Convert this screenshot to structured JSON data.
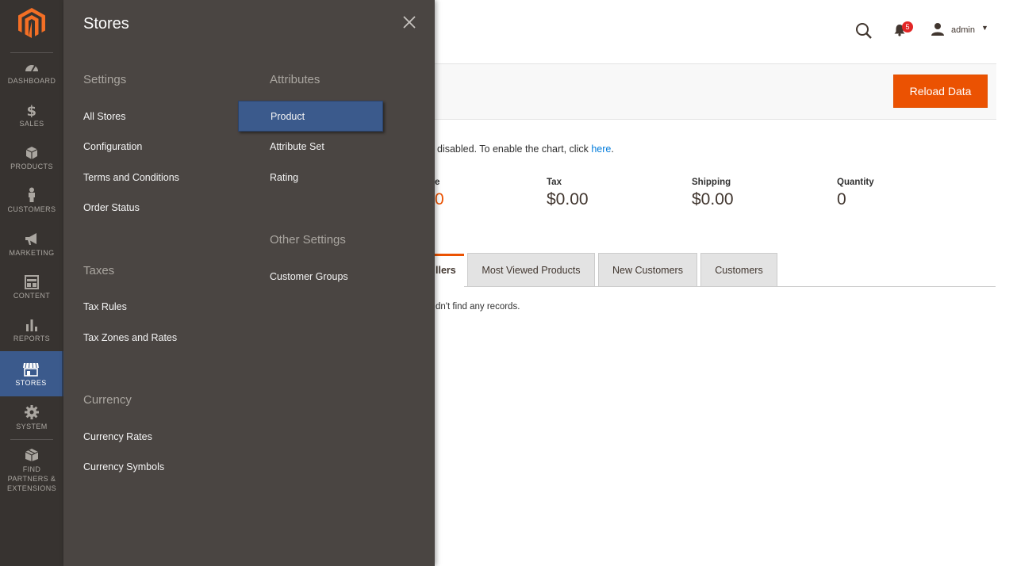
{
  "nav": {
    "items": [
      {
        "label": "DASHBOARD",
        "icon": "dashboard-icon"
      },
      {
        "label": "SALES",
        "icon": "dollar-icon"
      },
      {
        "label": "PRODUCTS",
        "icon": "cube-icon"
      },
      {
        "label": "CUSTOMERS",
        "icon": "person-icon"
      },
      {
        "label": "MARKETING",
        "icon": "megaphone-icon"
      },
      {
        "label": "CONTENT",
        "icon": "layout-icon"
      },
      {
        "label": "REPORTS",
        "icon": "bar-chart-icon"
      },
      {
        "label": "STORES",
        "icon": "storefront-icon"
      },
      {
        "label": "SYSTEM",
        "icon": "gear-icon"
      },
      {
        "label_lines": [
          "FIND",
          "PARTNERS &",
          "EXTENSIONS"
        ],
        "icon": "box-icon"
      }
    ],
    "active": "STORES"
  },
  "panel": {
    "title": "Stores",
    "groups": {
      "settings": {
        "title": "Settings",
        "links": [
          "All Stores",
          "Configuration",
          "Terms and Conditions",
          "Order Status"
        ]
      },
      "taxes": {
        "title": "Taxes",
        "links": [
          "Tax Rules",
          "Tax Zones and Rates"
        ]
      },
      "currency": {
        "title": "Currency",
        "links": [
          "Currency Rates",
          "Currency Symbols"
        ]
      },
      "attributes": {
        "title": "Attributes",
        "links": [
          "Product",
          "Attribute Set",
          "Rating"
        ]
      },
      "other": {
        "title": "Other Settings",
        "links": [
          "Customer Groups"
        ]
      }
    },
    "active_link": "Product"
  },
  "header": {
    "notification_count": "5",
    "user": "admin"
  },
  "actions": {
    "reload": "Reload Data"
  },
  "chart_message": {
    "prefix": "disabled. To enable the chart, click",
    "link": "here",
    "suffix": "."
  },
  "stats": [
    {
      "label": "e",
      "value": "0"
    },
    {
      "label": "Tax",
      "value": "$0.00"
    },
    {
      "label": "Shipping",
      "value": "$0.00"
    },
    {
      "label": "Quantity",
      "value": "0"
    }
  ],
  "tabs": {
    "active_partial": "llers",
    "items": [
      "Most Viewed Products",
      "New Customers",
      "Customers"
    ]
  },
  "empty_message": "dn't find any records.",
  "colors": {
    "accent": "#eb5202",
    "active_nav": "#3b5a8c",
    "panel_bg": "#4a4542",
    "rail_bg": "#373330"
  }
}
